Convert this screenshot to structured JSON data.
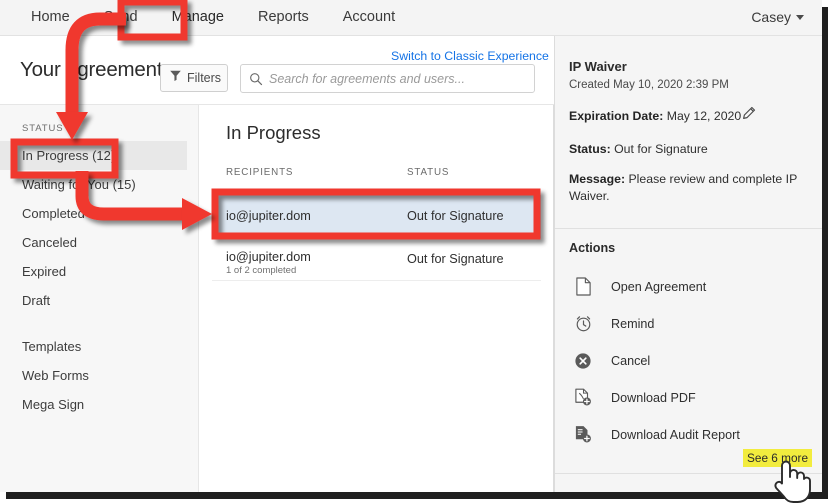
{
  "topnav": {
    "items": [
      {
        "label": "Home"
      },
      {
        "label": "Send"
      },
      {
        "label": "Manage"
      },
      {
        "label": "Reports"
      },
      {
        "label": "Account"
      }
    ],
    "user": "Casey"
  },
  "subheader": {
    "page_title": "Your agreements",
    "filters_label": "Filters",
    "search_placeholder": "Search for agreements and users...",
    "switch_link": "Switch to Classic Experience"
  },
  "sidebar": {
    "status_label": "STATUS",
    "status_items": [
      {
        "label": "In Progress (12)",
        "selected": true
      },
      {
        "label": "Waiting for You (15)",
        "selected": false
      },
      {
        "label": "Completed",
        "selected": false
      },
      {
        "label": "Canceled",
        "selected": false
      },
      {
        "label": "Expired",
        "selected": false
      },
      {
        "label": "Draft",
        "selected": false
      }
    ],
    "other_items": [
      {
        "label": "Templates"
      },
      {
        "label": "Web Forms"
      },
      {
        "label": "Mega Sign"
      }
    ]
  },
  "main": {
    "title": "In Progress",
    "columns": [
      "RECIPIENTS",
      "STATUS"
    ],
    "rows": [
      {
        "recipient": "io@jupiter.dom",
        "sub": "",
        "status": "Out for Signature",
        "selected": true
      },
      {
        "recipient": "io@jupiter.dom",
        "sub": "1 of 2 completed",
        "status": "Out for Signature",
        "selected": false
      }
    ]
  },
  "detail": {
    "title": "IP Waiver",
    "created": "Created May 10, 2020 2:39 PM",
    "expiration_key": "Expiration Date:",
    "expiration_value": "May 12, 2020",
    "status_key": "Status:",
    "status_value": "Out for Signature",
    "message_key": "Message:",
    "message_value": "Please review and complete IP Waiver.",
    "actions_title": "Actions",
    "actions": [
      {
        "label": "Open Agreement",
        "icon": "document-icon"
      },
      {
        "label": "Remind",
        "icon": "alarm-clock-icon"
      },
      {
        "label": "Cancel",
        "icon": "cancel-circle-icon"
      },
      {
        "label": "Download PDF",
        "icon": "download-pdf-icon"
      },
      {
        "label": "Download Audit Report",
        "icon": "download-audit-icon"
      }
    ],
    "see_more": "See 6 more"
  },
  "annotations": {
    "accent_color": "#f0372f",
    "highlight_color": "#f2ec3e",
    "selected_row_color": "#dde7f2"
  }
}
